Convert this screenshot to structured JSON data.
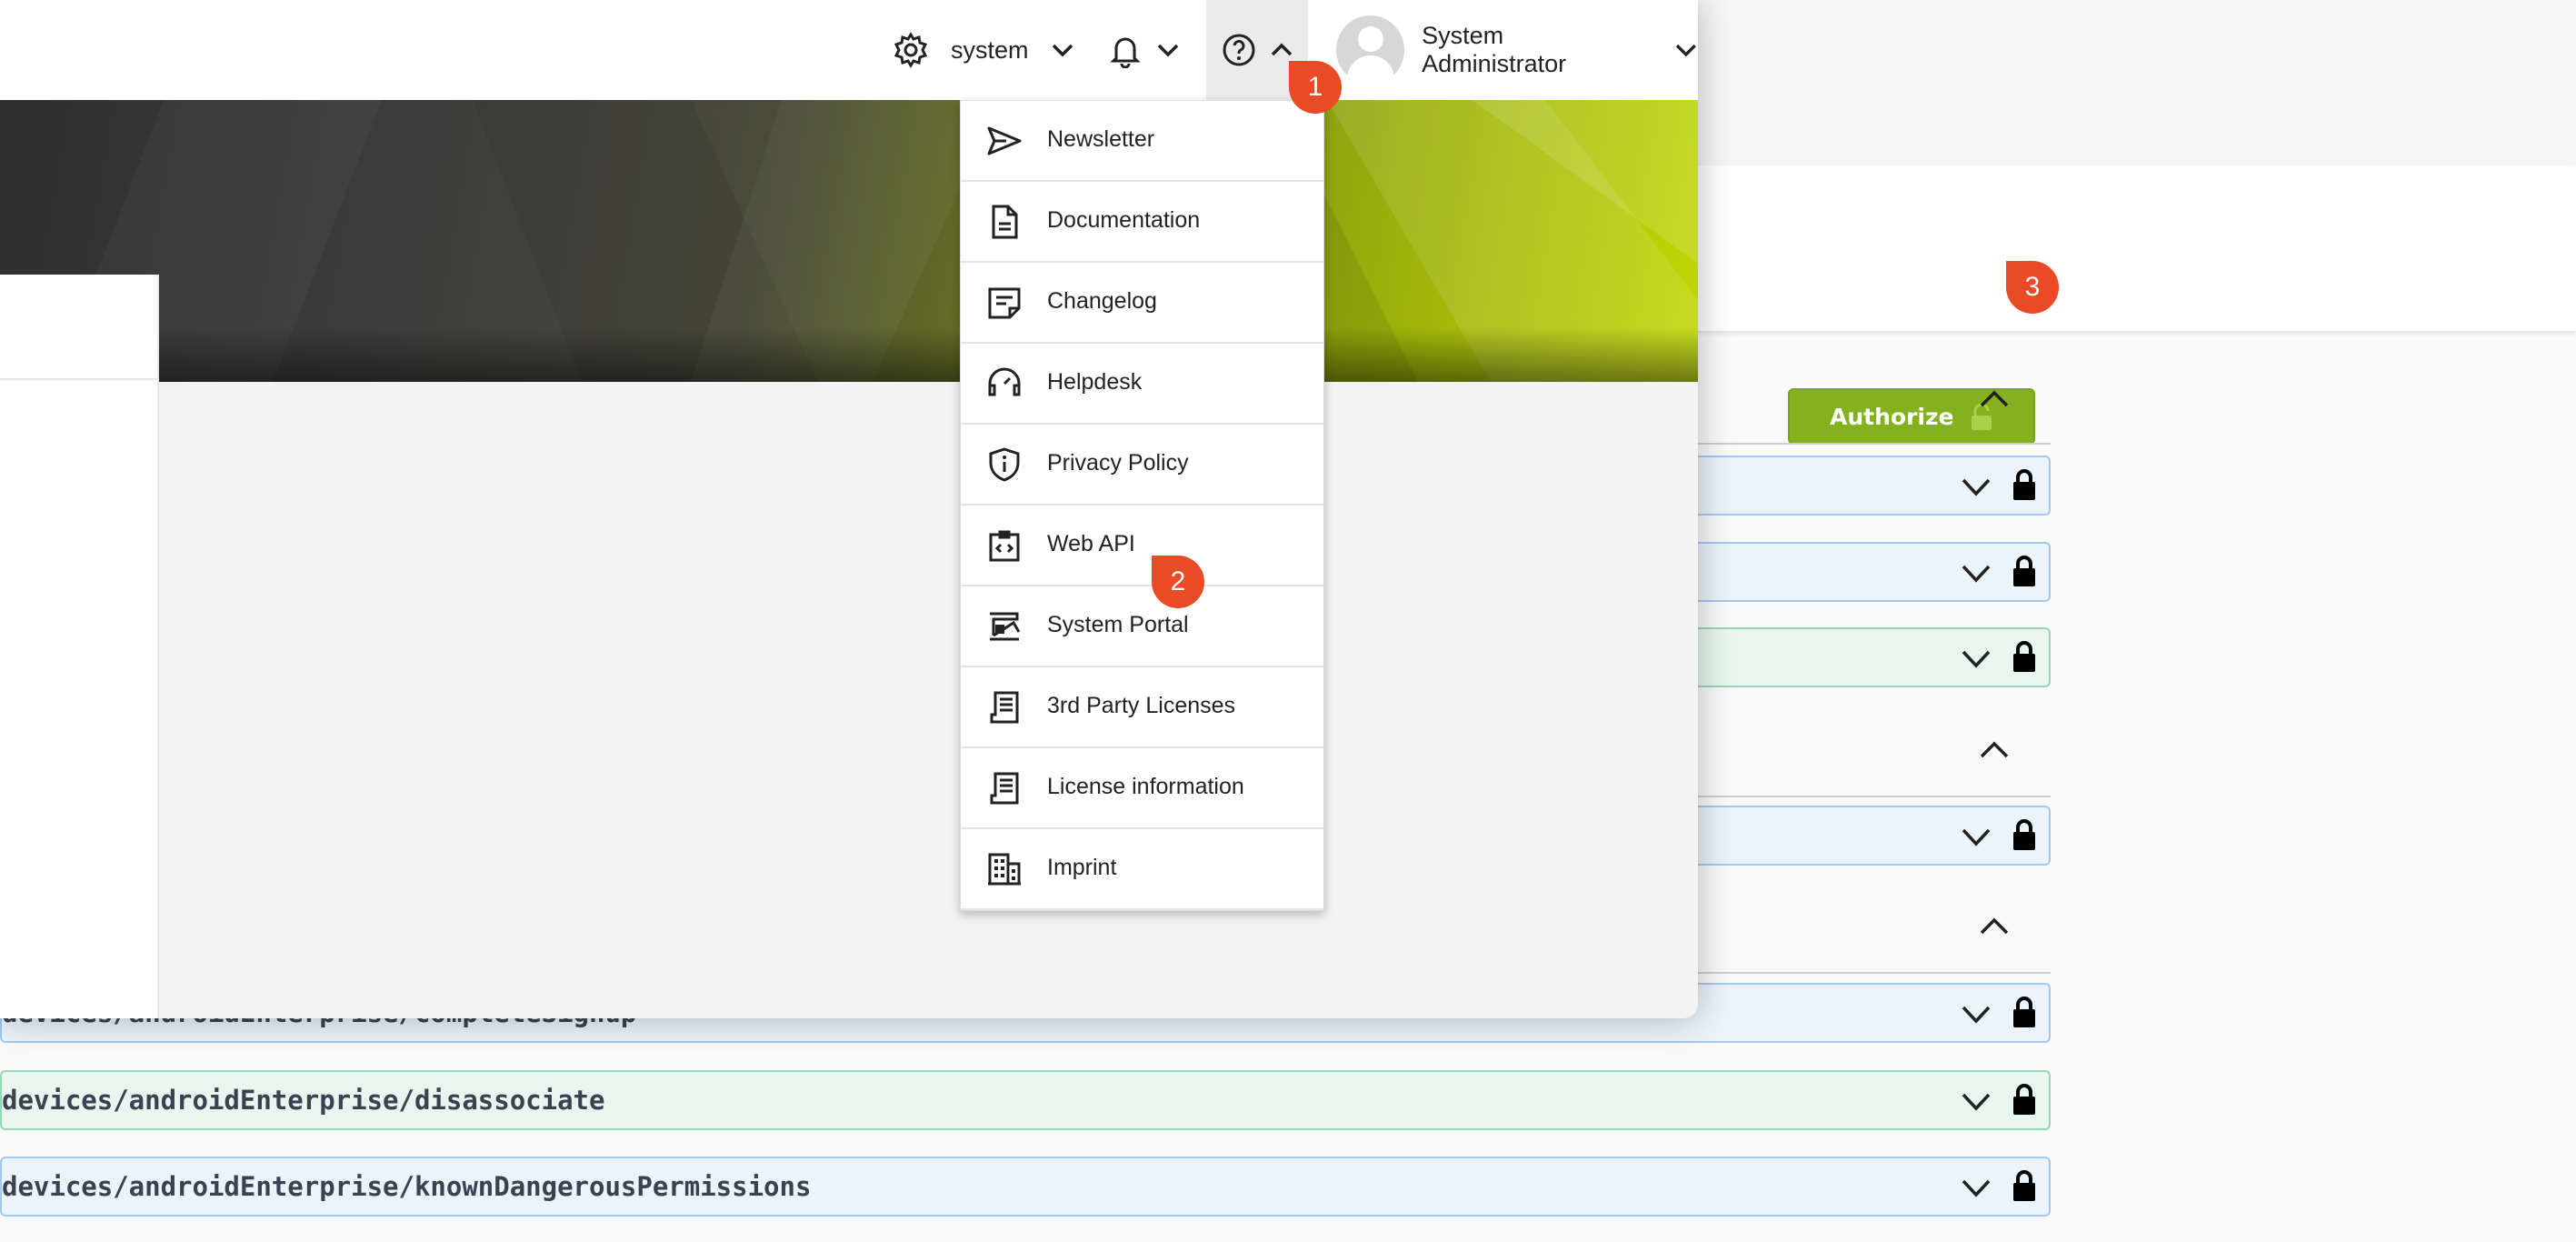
{
  "background": {
    "authorize_label": "Authorize",
    "operations": [
      {
        "method": "get",
        "path": ""
      },
      {
        "method": "get",
        "path": ""
      },
      {
        "method": "post",
        "path": ""
      },
      {
        "method": "get",
        "path": ""
      },
      {
        "method": "get",
        "path": "devices/androidEnterprise/completeSignup"
      },
      {
        "method": "post",
        "path": "devices/androidEnterprise/disassociate"
      },
      {
        "method": "get",
        "path": "devices/androidEnterprise/knownDangerousPermissions"
      }
    ]
  },
  "header": {
    "settings_label": "system",
    "user_name": "System Administrator"
  },
  "help_menu": {
    "items": [
      {
        "label": "Newsletter",
        "icon": "send-icon"
      },
      {
        "label": "Documentation",
        "icon": "document-icon"
      },
      {
        "label": "Changelog",
        "icon": "changelog-icon"
      },
      {
        "label": "Helpdesk",
        "icon": "headset-icon"
      },
      {
        "label": "Privacy Policy",
        "icon": "shield-info-icon"
      },
      {
        "label": "Web API",
        "icon": "code-icon"
      },
      {
        "label": "System Portal",
        "icon": "portal-icon"
      },
      {
        "label": "3rd Party Licenses",
        "icon": "license-icon"
      },
      {
        "label": "License information",
        "icon": "license-icon"
      },
      {
        "label": "Imprint",
        "icon": "building-icon"
      }
    ]
  },
  "badges": {
    "step1": "1",
    "step2": "2",
    "step3": "3"
  },
  "colors": {
    "accent_green": "#84b11e",
    "badge_red": "#ea4a26",
    "get_blue_bg": "#ebf3fb",
    "post_green_bg": "#e8f6ef"
  }
}
